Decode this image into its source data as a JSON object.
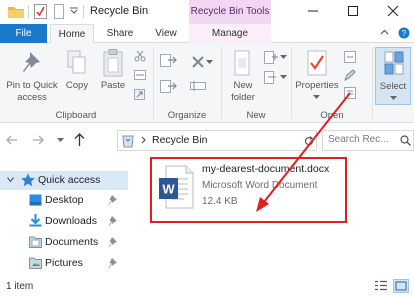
{
  "window": {
    "title": "Recycle Bin",
    "context_tab_header": "Recycle Bin Tools"
  },
  "tabs": {
    "file": "File",
    "home": "Home",
    "share": "Share",
    "view": "View",
    "manage": "Manage"
  },
  "ribbon": {
    "pin_line1": "Pin to Quick",
    "pin_line2": "access",
    "copy": "Copy",
    "paste": "Paste",
    "new_folder_line1": "New",
    "new_folder_line2": "folder",
    "properties": "Properties",
    "select": "Select",
    "groups": {
      "clipboard": "Clipboard",
      "organize": "Organize",
      "new": "New",
      "open": "Open"
    }
  },
  "address": {
    "path": "Recycle Bin",
    "search_placeholder": "Search Rec..."
  },
  "nav": {
    "quick_access": "Quick access",
    "items": [
      {
        "label": "Desktop"
      },
      {
        "label": "Downloads"
      },
      {
        "label": "Documents"
      },
      {
        "label": "Pictures"
      }
    ]
  },
  "file": {
    "name": "my-dearest-document.docx",
    "type": "Microsoft Word Document",
    "size": "12.4 KB",
    "icon": "word-document-icon"
  },
  "status": {
    "count": "1 item"
  },
  "colors": {
    "file_tab": "#1979ca",
    "context_tab": "#f2d7f4",
    "highlight_box": "#e0201f",
    "quick_access_bg": "#d9e8f7"
  }
}
